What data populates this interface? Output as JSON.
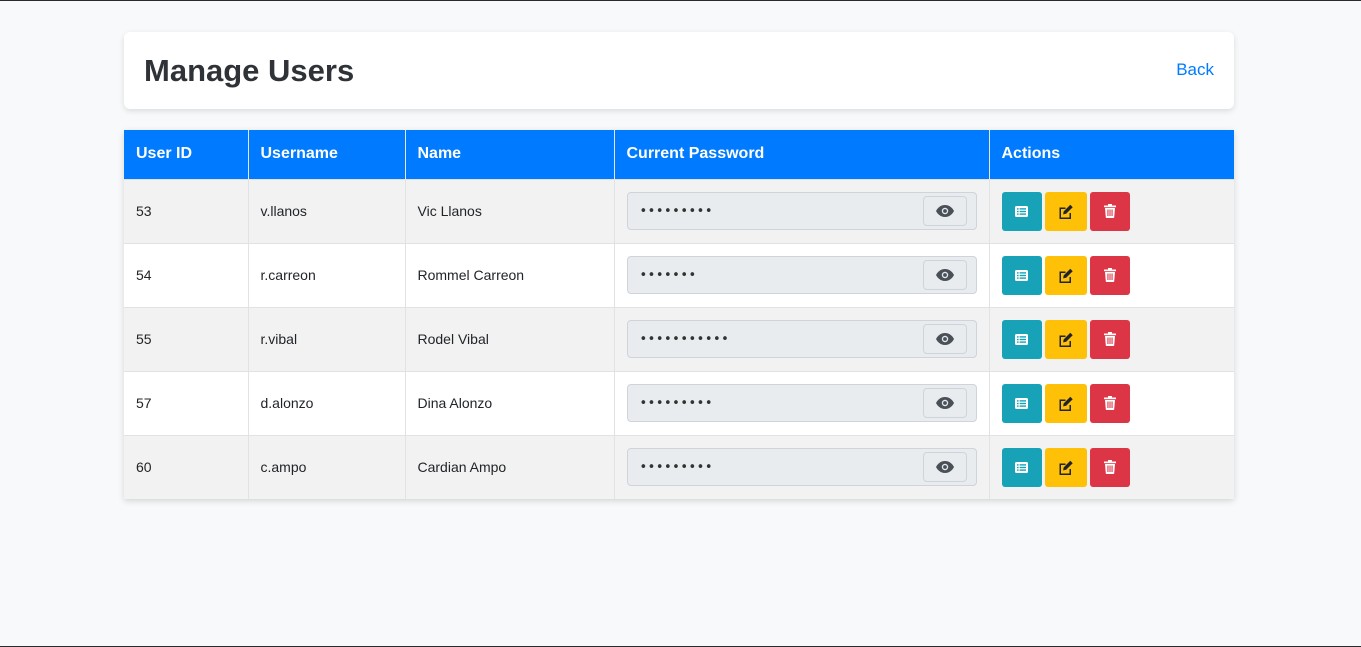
{
  "header": {
    "title": "Manage Users",
    "back_label": "Back"
  },
  "table": {
    "columns": [
      "User ID",
      "Username",
      "Name",
      "Current Password",
      "Actions"
    ],
    "rows": [
      {
        "id": "53",
        "username": "v.llanos",
        "name": "Vic Llanos",
        "password_mask": "•••••••••"
      },
      {
        "id": "54",
        "username": "r.carreon",
        "name": "Rommel Carreon",
        "password_mask": "•••••••"
      },
      {
        "id": "55",
        "username": "r.vibal",
        "name": "Rodel Vibal",
        "password_mask": "•••••••••••"
      },
      {
        "id": "57",
        "username": "d.alonzo",
        "name": "Dina Alonzo",
        "password_mask": "•••••••••"
      },
      {
        "id": "60",
        "username": "c.ampo",
        "name": "Cardian Ampo",
        "password_mask": "•••••••••"
      }
    ]
  },
  "icons": {
    "toggle_password": "eye-icon",
    "view": "list-icon",
    "edit": "edit-icon",
    "delete": "trash-icon"
  },
  "colors": {
    "primary": "#007bff",
    "info": "#17a2b8",
    "warning": "#ffc107",
    "danger": "#dc3545"
  }
}
